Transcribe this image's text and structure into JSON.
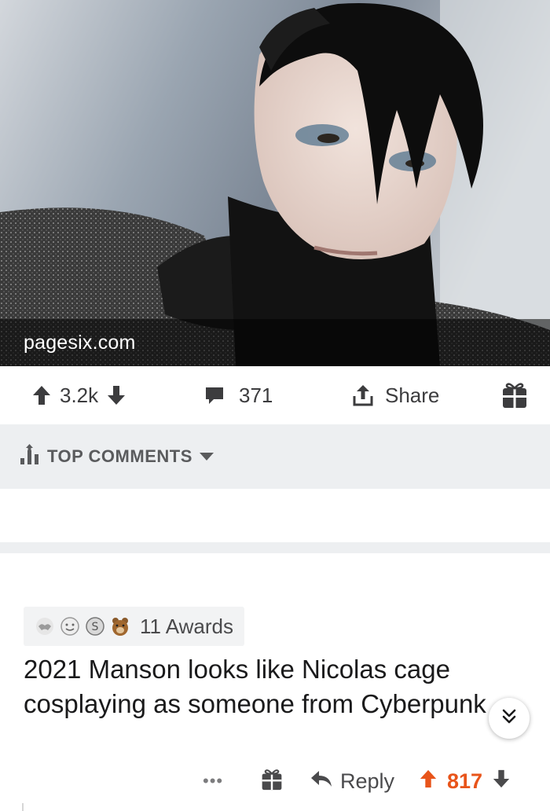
{
  "post": {
    "link_domain": "pagesix.com",
    "upvotes": "3.2k",
    "comments_count": "371",
    "share_label": "Share"
  },
  "sort": {
    "label": "TOP COMMENTS"
  },
  "comment": {
    "awards_label": "11 Awards",
    "body": "2021 Manson looks like Nicolas cage cosplaying as someone from Cyberpunk",
    "more_label": "•••",
    "reply_label": "Reply",
    "score": "817"
  },
  "colors": {
    "upvote_active": "#e8541a",
    "sort_bar_bg": "#edeff1",
    "icon_grey": "#3c3c3e"
  },
  "icons": {
    "upvote": "arrow-up-icon",
    "downvote": "arrow-down-icon",
    "comments": "speech-bubble-icon",
    "share": "share-icon",
    "gift": "gift-icon",
    "sort": "bar-chart-icon",
    "collapse": "double-chevron-down-icon",
    "reply": "reply-arrow-icon"
  }
}
